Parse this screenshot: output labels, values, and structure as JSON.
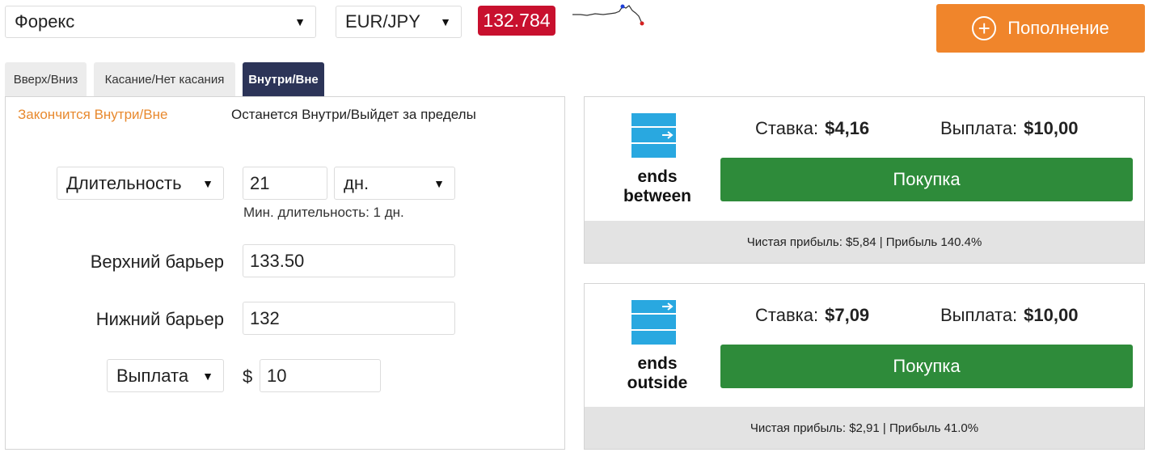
{
  "top": {
    "market_select": "Форекс",
    "asset_select": "EUR/JPY",
    "price": "132.784",
    "deposit_label": "Пополнение"
  },
  "tabs": [
    "Вверх/Вниз",
    "Касание/Нет касания",
    "Внутри/Вне"
  ],
  "subtabs": [
    "Закончится Внутри/Вне",
    "Останется Внутри/Выйдет за пределы"
  ],
  "form": {
    "duration_select": "Длительность",
    "duration_value": "21",
    "duration_unit": "дн.",
    "min_duration_hint": "Мин. длительность: 1 дн.",
    "upper_barrier_label": "Верхний барьер",
    "upper_barrier_value": "133.50",
    "lower_barrier_label": "Нижний барьер",
    "lower_barrier_value": "132",
    "payout_select": "Выплата",
    "currency_symbol": "$",
    "payout_value": "10"
  },
  "cards": [
    {
      "type_label_1": "ends",
      "type_label_2": "between",
      "stake_label": "Ставка:",
      "stake_value": "$4,16",
      "payout_label": "Выплата:",
      "payout_value": "$10,00",
      "buy_label": "Покупка",
      "footer": "Чистая прибыль: $5,84 | Прибыль 140.4%"
    },
    {
      "type_label_1": "ends",
      "type_label_2": "outside",
      "stake_label": "Ставка:",
      "stake_value": "$7,09",
      "payout_label": "Выплата:",
      "payout_value": "$10,00",
      "buy_label": "Покупка",
      "footer": "Чистая прибыль: $2,91 | Прибыль 41.0%"
    }
  ],
  "colors": {
    "price_badge": "#c8102e",
    "deposit_button": "#f0852b",
    "active_tab": "#2c3458",
    "active_subtab": "#e8892e",
    "buy_button": "#2e8b3a",
    "contract_icon": "#29a8e0"
  },
  "icons": {
    "deposit": "plus-circle-icon",
    "contract": "barrier-range-icon",
    "sparkline": "price-sparkline"
  }
}
